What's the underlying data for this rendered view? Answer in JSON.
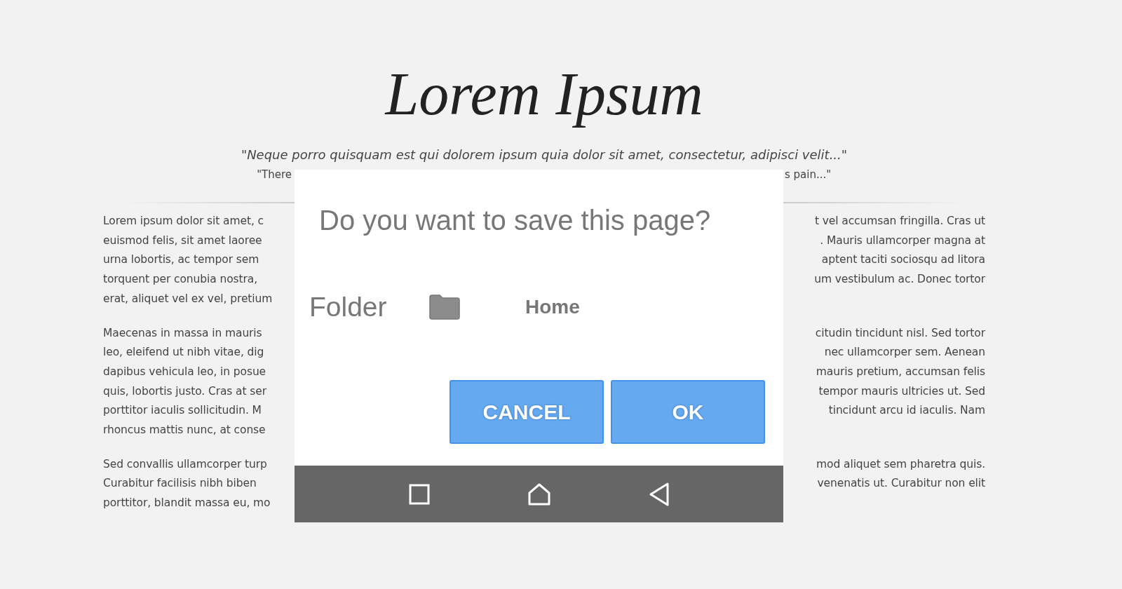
{
  "article": {
    "title": "Lorem Ipsum",
    "quote": "\"Neque porro quisquam est qui dolorem ipsum quia dolor sit amet, consectetur, adipisci velit...\"",
    "subquote_left": "\"There",
    "subquote_right": "s pain...\"",
    "paragraphs": [
      {
        "lines": [
          {
            "left": "Lorem ipsum dolor sit amet, c",
            "right": "t vel accumsan fringilla. Cras ut"
          },
          {
            "left": "euismod felis, sit amet laoree",
            "right": ". Mauris ullamcorper magna at"
          },
          {
            "left": "urna lobortis, ac tempor sem",
            "right": "aptent taciti sociosqu ad litora"
          },
          {
            "left": "torquent per conubia nostra,",
            "right": "um vestibulum ac. Donec tortor"
          },
          {
            "left": "erat, aliquet vel ex vel, pretium"
          }
        ]
      },
      {
        "lines": [
          {
            "left": "Maecenas in massa in mauris",
            "right": "citudin tincidunt nisl. Sed tortor"
          },
          {
            "left": "leo, eleifend ut nibh vitae, dig",
            "right": "nec ullamcorper sem. Aenean"
          },
          {
            "left": "dapibus vehicula leo, in posue",
            "right": "mauris pretium, accumsan felis"
          },
          {
            "left": "quis, lobortis justo. Cras at ser",
            "right": "tempor mauris ultricies ut. Sed"
          },
          {
            "left": "porttitor iaculis sollicitudin. M",
            "right": "tincidunt arcu id iaculis. Nam"
          },
          {
            "left": "rhoncus mattis nunc, at conse"
          }
        ]
      },
      {
        "lines": [
          {
            "left": "Sed convallis ullamcorper turp",
            "right": "mod aliquet sem pharetra quis."
          },
          {
            "left": "Curabitur facilisis nibh biben",
            "right": "venenatis ut. Curabitur non elit"
          },
          {
            "left": "porttitor, blandit massa eu, mo"
          }
        ]
      }
    ]
  },
  "dialog": {
    "title": "Do you want to save this page?",
    "folder_label": "Folder",
    "folder_value": "Home",
    "buttons": [
      {
        "label": "CANCEL"
      },
      {
        "label": "OK"
      }
    ],
    "nav_bar": [
      {
        "kind": "recents"
      },
      {
        "kind": "home"
      },
      {
        "kind": "back"
      }
    ]
  }
}
